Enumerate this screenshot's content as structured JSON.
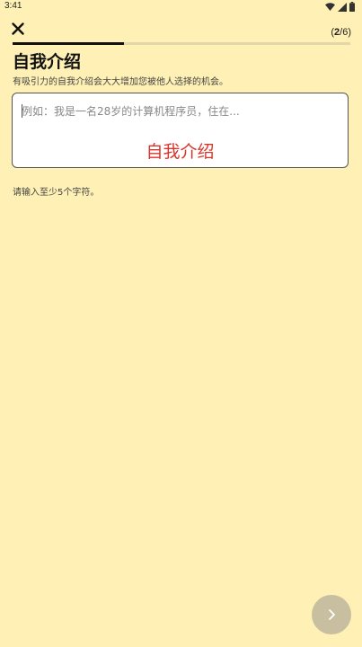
{
  "status_bar": {
    "time": "3:41",
    "icons": [
      "wifi-icon",
      "signal-icon",
      "battery-icon"
    ]
  },
  "header": {
    "close_icon": "close-icon",
    "step_current": "2",
    "step_total": "/6",
    "step_open": "(",
    "step_close": ")",
    "progress": 0.33
  },
  "page": {
    "title": "自我介绍",
    "subtitle": "有吸引力的自我介绍会大大增加您被他人选择的机会。"
  },
  "bio_field": {
    "placeholder": "例如：我是一名28岁的计算机程序员，住在...",
    "value": "",
    "overlay_label": "自我介绍"
  },
  "hint": "请输入至少5个字符。",
  "footer": {
    "next_icon": "chevron-right-icon"
  },
  "colors": {
    "background": "#FFF1B5",
    "accent_red": "#D9342B",
    "next_button": "#C8BFA0"
  }
}
